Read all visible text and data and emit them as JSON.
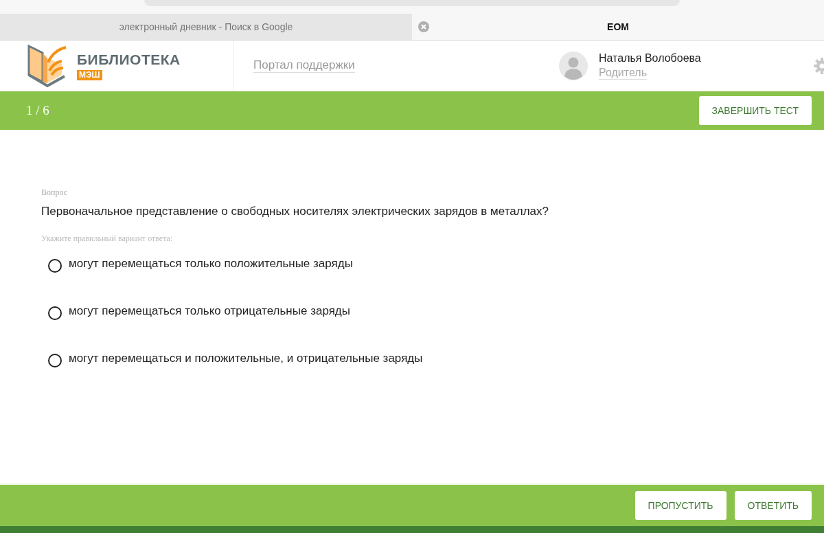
{
  "browser_tabs": [
    {
      "label": "электронный дневник - Поиск в Google",
      "selected": false
    },
    {
      "label": "ЕОМ",
      "selected": true
    }
  ],
  "header": {
    "logo_title": "БИБЛИОТЕКА",
    "logo_badge": "МЭШ",
    "support_link": "Портал поддержки",
    "user_name": "Наталья Волобоева",
    "user_role": "Родитель"
  },
  "test_bar": {
    "progress": "1 / 6",
    "finish_button": "ЗАВЕРШИТЬ ТЕСТ"
  },
  "question": {
    "label": "Вопрос",
    "text": "Первоначальное представление о свободных носителях электрических зарядов в металлах?",
    "hint": "Укажите правильный вариант ответа:",
    "options": [
      {
        "text": "могут перемещаться только положительные заряды",
        "selected": false
      },
      {
        "text": "могут перемещаться только отрицательные заряды",
        "selected": false
      },
      {
        "text": "могут перемещаться и положительные, и отрицательные заряды",
        "selected": false
      }
    ]
  },
  "footer": {
    "buttons": [
      "ПРОПУСТИТЬ",
      "ОТВЕТИТЬ"
    ]
  }
}
